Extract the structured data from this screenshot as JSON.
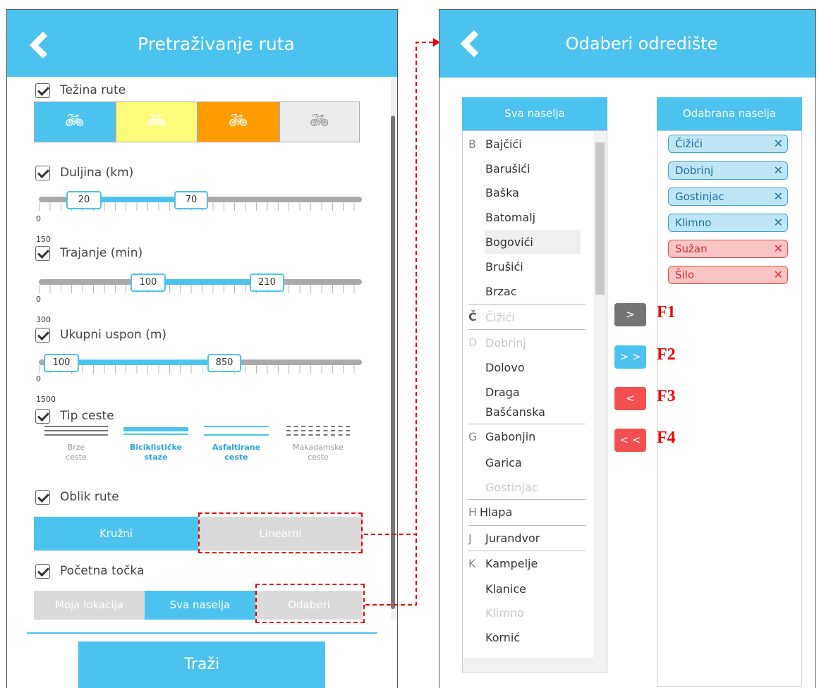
{
  "left": {
    "title": "Pretraživanje ruta",
    "sections": {
      "difficulty": "Težina rute",
      "length": "Duljina (km)",
      "duration": "Trajanje (min)",
      "ascent": "Ukupni uspon (m)",
      "road_type": "Tip ceste",
      "route_shape": "Oblik rute",
      "start_point": "Početna točka"
    },
    "difficulty_colors": [
      "#4cc3ef",
      "#fdfb7a",
      "#ff9c00",
      "#ececec"
    ],
    "sliders": {
      "length": {
        "min": "0",
        "max": "150",
        "low": "20",
        "high": "70"
      },
      "duration": {
        "min": "0",
        "max": "300",
        "low": "100",
        "high": "210"
      },
      "ascent": {
        "min": "0",
        "max": "1500",
        "low": "100",
        "high": "850"
      }
    },
    "roads": [
      {
        "line1": "Brze",
        "line2": "ceste"
      },
      {
        "line1": "Biciklističke",
        "line2": "staze"
      },
      {
        "line1": "Asfaltirane",
        "line2": "ceste"
      },
      {
        "line1": "Makadamske",
        "line2": "ceste"
      }
    ],
    "shape_buttons": {
      "circular": "Kružni",
      "linear": "Linearni"
    },
    "start_buttons": {
      "my_location": "Moja lokacija",
      "all_places": "Sva naselja",
      "choose": "Odaberi"
    },
    "search_button": "Traži"
  },
  "right": {
    "title": "Odaberi odredište",
    "all_header": "Sva naselja",
    "selected_header": "Odabrana naselja",
    "letters": [
      "B",
      "Č",
      "D",
      "G",
      "H",
      "J",
      "K"
    ],
    "places": [
      "Bajčići",
      "Barušići",
      "Baška",
      "Batomalj",
      "Bogovići",
      "Brušići",
      "Brzac",
      "Čižići",
      "Dobrinj",
      "Dolovo",
      "Draga",
      "Bašćanska",
      "Gabonjin",
      "Garica",
      "Gostinjac",
      "Hlapa",
      "Jurandvor",
      "Kampelje",
      "Klanice",
      "Klimno",
      "Kornić"
    ],
    "selected": [
      "Čižići",
      "Dobrinj",
      "Gostinjac",
      "Klimno",
      "Sužan",
      "Šilo"
    ],
    "remove_glyph": "✕",
    "move_buttons": [
      ">",
      "> >",
      "<",
      "< <"
    ],
    "f_labels": [
      "F1",
      "F2",
      "F3",
      "F4"
    ]
  }
}
